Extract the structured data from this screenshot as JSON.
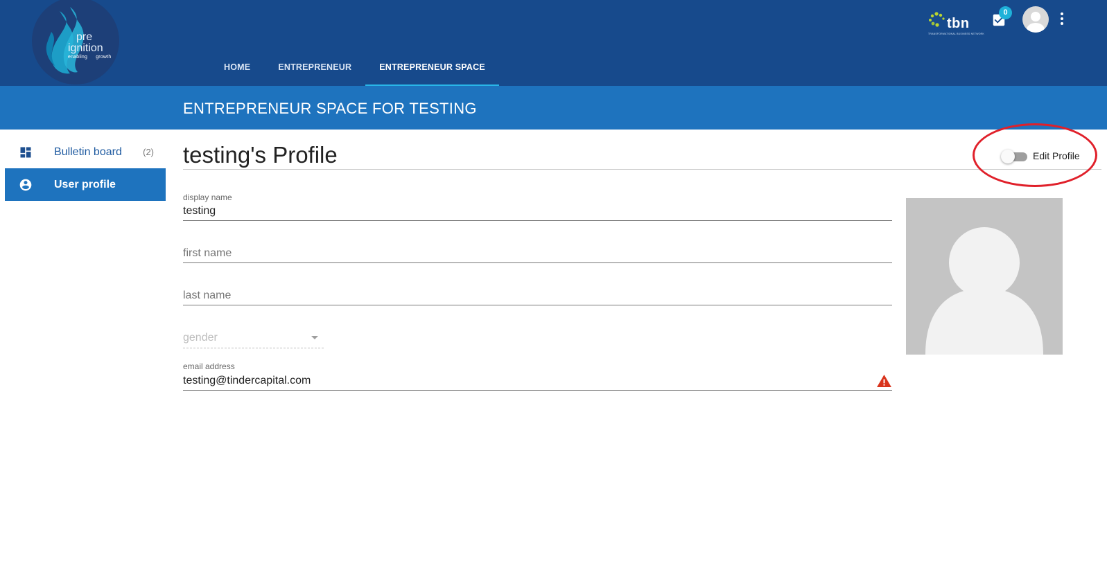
{
  "header": {
    "logo": {
      "line1": "pre",
      "line2": "ignition",
      "tagline": "enabling growth"
    },
    "nav": [
      {
        "label": "HOME",
        "active": false
      },
      {
        "label": "ENTREPRENEUR",
        "active": false
      },
      {
        "label": "ENTREPRENEUR SPACE",
        "active": true
      }
    ],
    "partner_logo": {
      "text": "tbn",
      "subtext": "TRANSFORMATIONAL BUSINESS NETWORK"
    },
    "notifications": {
      "count": "0",
      "icon": "checkbox-tasks-icon"
    },
    "user_avatar_icon": "account-circle-icon",
    "menu_icon": "more-vertical-icon"
  },
  "space": {
    "title": "ENTREPRENEUR SPACE FOR TESTING"
  },
  "sidebar": {
    "items": [
      {
        "label": "Bulletin board",
        "count": "(2)",
        "icon": "dashboard-icon",
        "active": false
      },
      {
        "label": "User profile",
        "count": "",
        "icon": "account-circle-icon",
        "active": true
      }
    ]
  },
  "profile": {
    "title": "testing's Profile",
    "edit_toggle": {
      "label": "Edit Profile",
      "on": false
    },
    "fields": {
      "display_name": {
        "label": "display name",
        "value": "testing"
      },
      "first_name": {
        "placeholder": "first name",
        "value": ""
      },
      "last_name": {
        "placeholder": "last name",
        "value": ""
      },
      "gender": {
        "placeholder": "gender",
        "value": ""
      },
      "email": {
        "label": "email address",
        "value": "testing@tindercapital.com",
        "warning_icon": "warning-triangle-icon"
      }
    },
    "photo_icon": "default-avatar-silhouette"
  },
  "annotation": {
    "color": "#e0202a"
  },
  "colors": {
    "header_bg": "#174a8c",
    "title_band_bg": "#1e73be",
    "active_tab_underline": "#29b6e8",
    "badge": "#1fb2d9",
    "warning": "#d9341d"
  }
}
